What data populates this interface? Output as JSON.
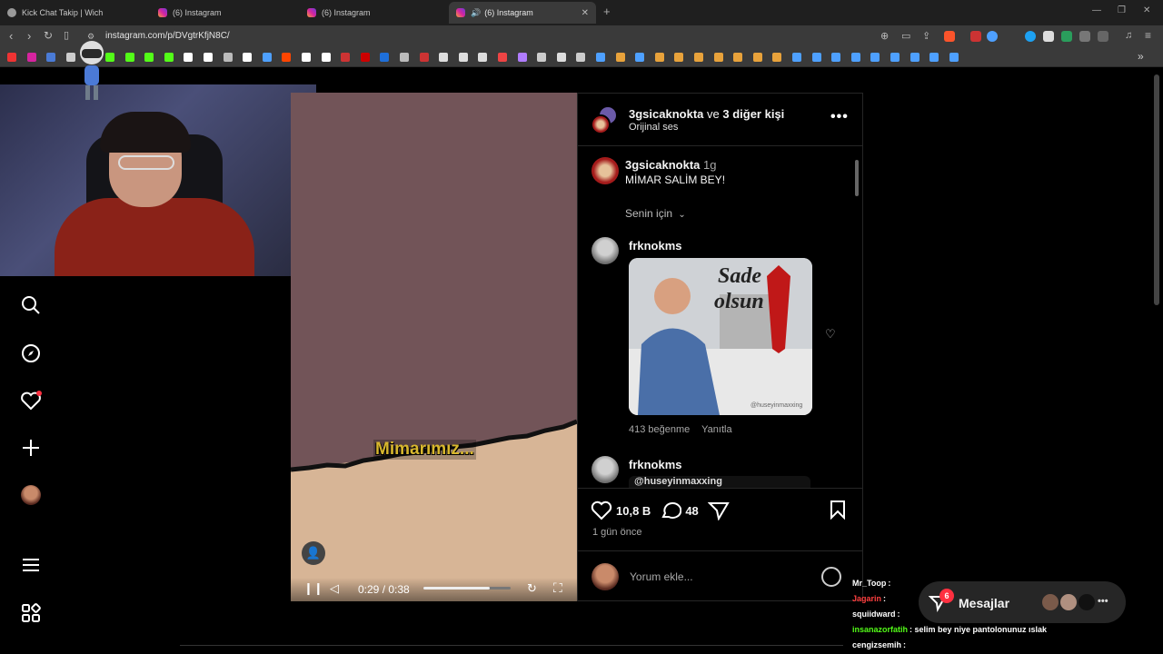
{
  "browser": {
    "tabs": [
      {
        "title": "Kick Chat Takip | Wich",
        "active": false
      },
      {
        "title": "(6) Instagram",
        "active": false
      },
      {
        "title": "(6) Instagram",
        "active": false
      },
      {
        "title": "(6) Instagram",
        "active": true
      }
    ],
    "new_tab": "+",
    "url": "instagram.com/p/DVgtrKfjN8C/"
  },
  "post": {
    "header_user": "3gsicaknokta",
    "header_connector": "ve",
    "header_others": "3 diğer kişi",
    "audio": "Orijinal ses",
    "caption_user": "3gsicaknokta",
    "caption_time": "1g",
    "caption_text": "MİMAR SALİM BEY!",
    "sort_label": "Senin için",
    "comments": [
      {
        "user": "frknokms",
        "likes": "413 beğenme",
        "reply": "Yanıtla",
        "meme_title_1": "Sade",
        "meme_title_2": "olsun",
        "meme_watermark": "@huseyinmaxxing"
      },
      {
        "user": "frknokms",
        "preview_text": "@huseyinmaxxing"
      }
    ],
    "like_count": "10,8 B",
    "comment_count": "48",
    "posted_ago": "1 gün önce",
    "comment_placeholder": "Yorum ekle..."
  },
  "video": {
    "caption_text": "Mimarımız...",
    "time": "0:29 / 0:38",
    "progress": 0.76
  },
  "messages": {
    "label": "Mesajlar",
    "badge": "6"
  },
  "chat_overlay": [
    {
      "user": "Mr_Toop",
      "text": ":",
      "color": "#ffffff"
    },
    {
      "user": "Jagarin",
      "text": ":",
      "color": "#ff4040"
    },
    {
      "user": "squiidward",
      "text": ":",
      "color": "#ffffff"
    },
    {
      "user": "insanazorfatih",
      "text": ": selim bey niye pantolonunuz ıslak",
      "color": "#53fc18"
    },
    {
      "user": "cengizsemih",
      "text": ":",
      "color": "#ffffff"
    }
  ],
  "colors": {
    "video_bg": "#725458",
    "sand": "#d7b596",
    "caption_yellow": "#d8b72e",
    "notif_red": "#ff3040"
  }
}
